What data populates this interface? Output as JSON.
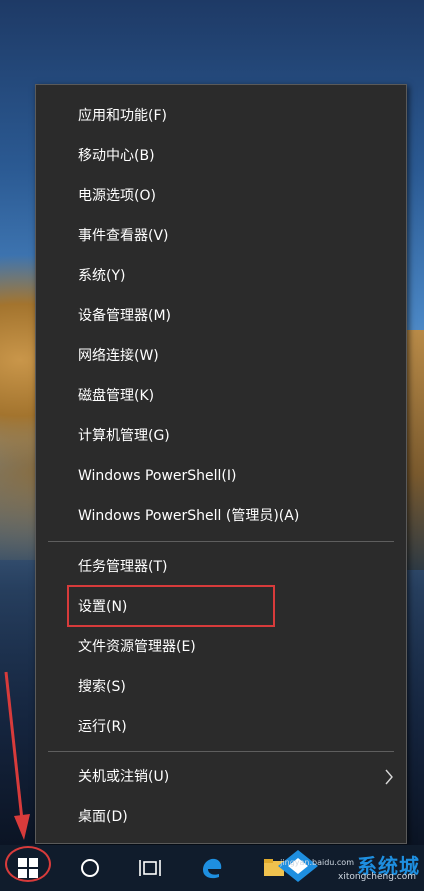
{
  "menu": {
    "group1": [
      {
        "label": "应用和功能(F)"
      },
      {
        "label": "移动中心(B)"
      },
      {
        "label": "电源选项(O)"
      },
      {
        "label": "事件查看器(V)"
      },
      {
        "label": "系统(Y)"
      },
      {
        "label": "设备管理器(M)"
      },
      {
        "label": "网络连接(W)"
      },
      {
        "label": "磁盘管理(K)"
      },
      {
        "label": "计算机管理(G)"
      },
      {
        "label": "Windows PowerShell(I)"
      },
      {
        "label": "Windows PowerShell (管理员)(A)"
      }
    ],
    "group2": [
      {
        "label": "任务管理器(T)"
      },
      {
        "label": "设置(N)"
      },
      {
        "label": "文件资源管理器(E)"
      },
      {
        "label": "搜索(S)"
      },
      {
        "label": "运行(R)"
      }
    ],
    "group3": [
      {
        "label": "关机或注销(U)",
        "submenu_icon": "chevron-right-icon"
      },
      {
        "label": "桌面(D)"
      }
    ]
  },
  "taskbar": {
    "icons": [
      "windows-start-icon",
      "search-circle-icon",
      "task-view-icon",
      "edge-icon",
      "file-explorer-icon"
    ]
  },
  "watermark": {
    "text": "系统城",
    "sub": "xitongcheng.com",
    "sub2": "jingyan.baidu.com"
  },
  "colors": {
    "menu_bg": "#2b2b2b",
    "highlight": "#d83b3b",
    "taskbar_bg": "#101c2c"
  }
}
